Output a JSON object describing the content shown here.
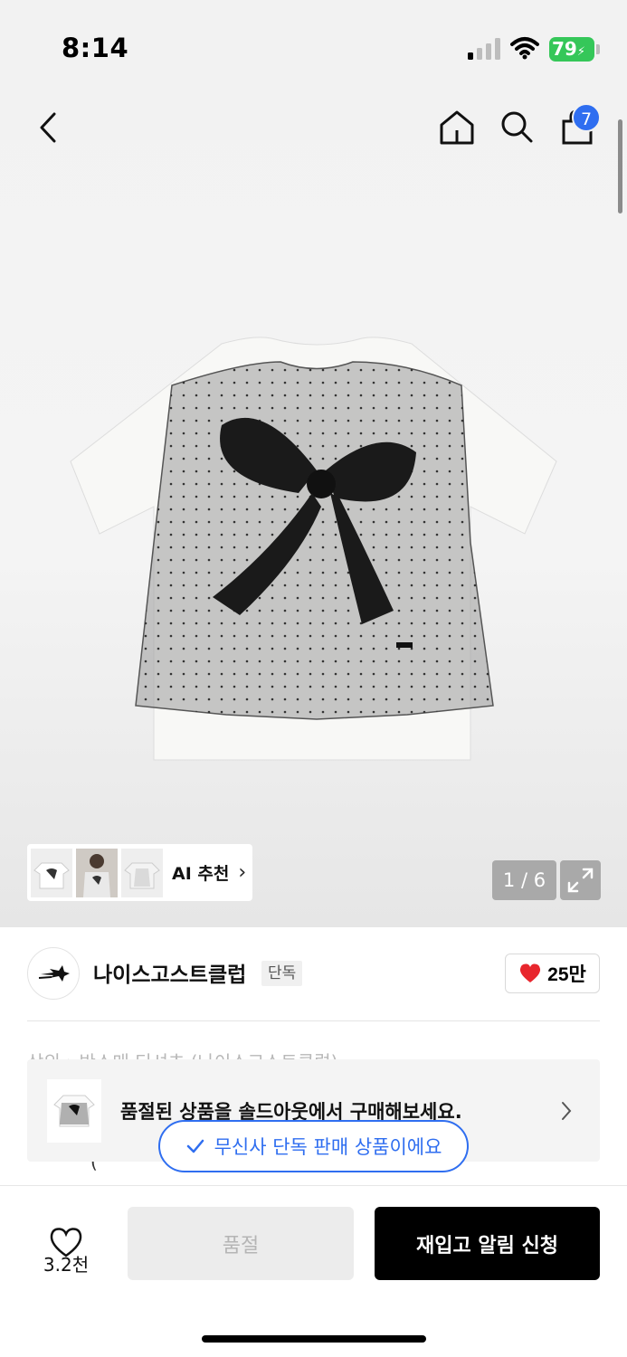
{
  "status_bar": {
    "time": "8:14",
    "battery": "79"
  },
  "nav": {
    "cart_badge": "7"
  },
  "gallery": {
    "ai_label": "AI 추천",
    "ai_chevron": "›",
    "page_counter": "1 / 6"
  },
  "brand": {
    "name": "나이스고스트클럽",
    "exclusive_tag": "단독",
    "likes": "25만"
  },
  "peek": {
    "title_partial": "상의 › 반소매 티셔츠 (나이스고스트클럽)",
    "paren": "("
  },
  "banner": {
    "text": "품절된 상품을 솔드아웃에서 구매해보세요."
  },
  "pill": {
    "text": "무신사 단독 판매 상품이에요"
  },
  "bottom_bar": {
    "wish_count": "3.2천",
    "soldout_label": "품절",
    "restock_label": "재입고 알림 신청"
  },
  "colors": {
    "accent_blue": "#2f6ef0",
    "heart_red": "#e8262d",
    "battery_green": "#35c759"
  },
  "icons": [
    "back-icon",
    "home-icon",
    "search-icon",
    "bag-icon",
    "expand-icon",
    "heart-icon",
    "check-icon",
    "chevron-right-icon"
  ]
}
